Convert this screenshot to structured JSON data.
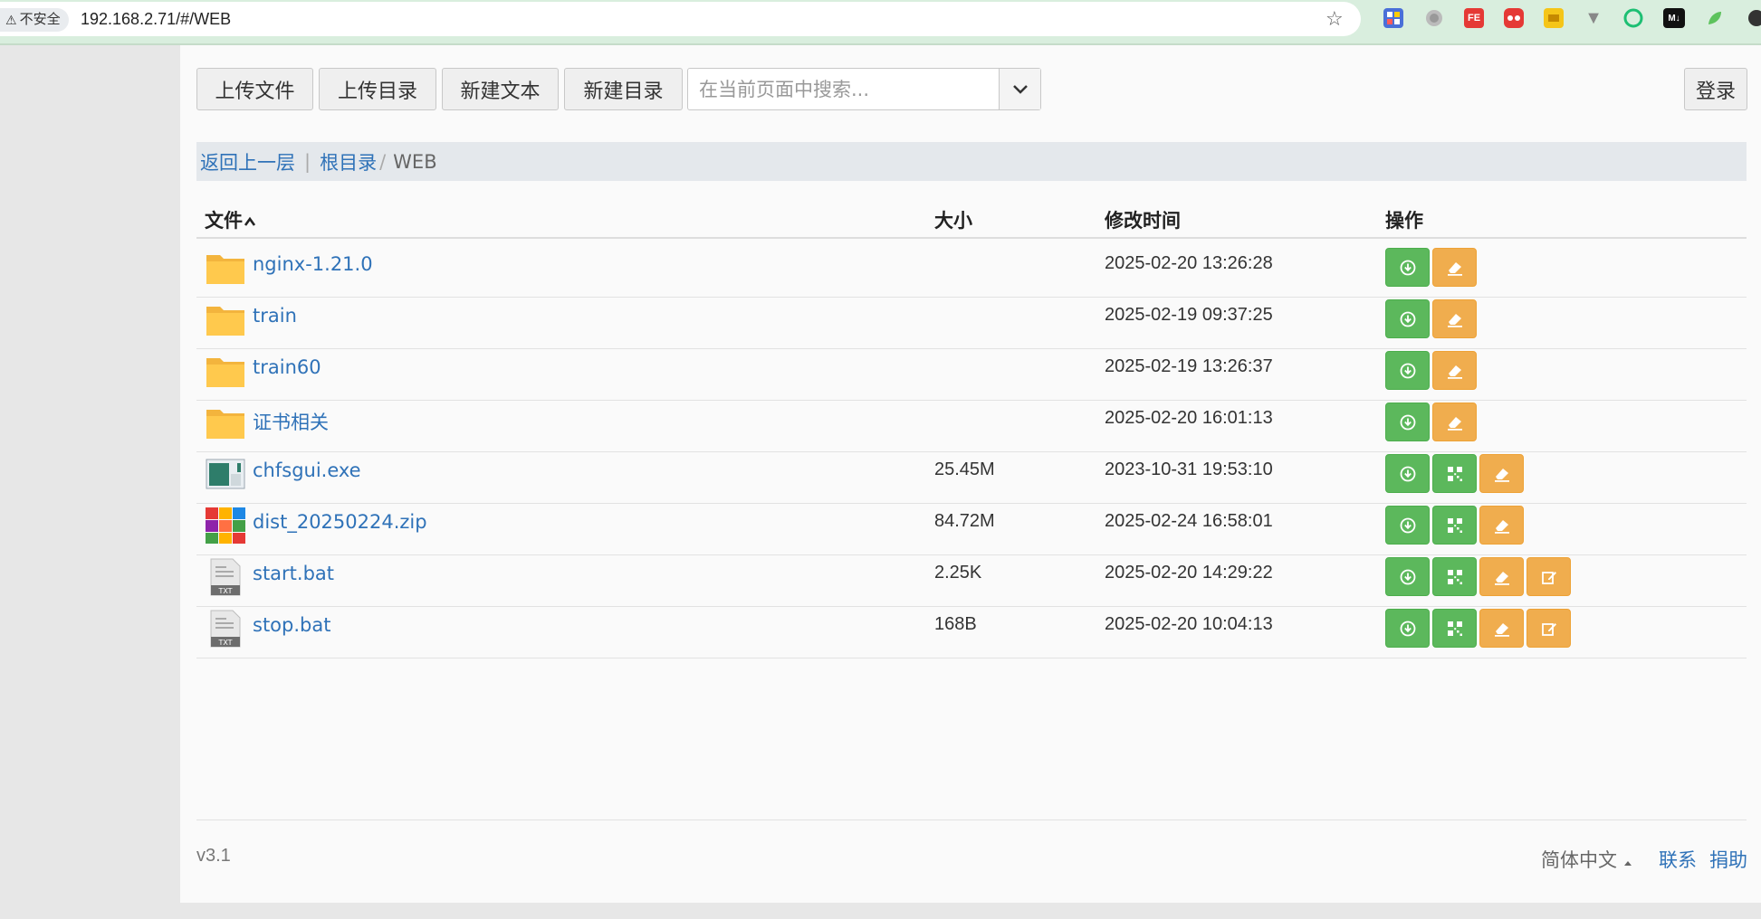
{
  "browser": {
    "security_label": "不安全",
    "url": "192.168.2.71/#/WEB"
  },
  "toolbar": {
    "upload_file": "上传文件",
    "upload_dir": "上传目录",
    "new_text": "新建文本",
    "new_dir": "新建目录",
    "search_placeholder": "在当前页面中搜索...",
    "login": "登录"
  },
  "breadcrumb": {
    "back": "返回上一层",
    "root": "根目录",
    "separator": "/",
    "current": "WEB"
  },
  "table": {
    "headers": {
      "name": "文件",
      "size": "大小",
      "modified": "修改时间",
      "actions": "操作"
    },
    "rows": [
      {
        "name": "nginx-1.21.0",
        "size": "",
        "modified": "2025-02-20 13:26:28",
        "type": "folder",
        "actions": [
          "download",
          "delete"
        ]
      },
      {
        "name": "train",
        "size": "",
        "modified": "2025-02-19 09:37:25",
        "type": "folder",
        "actions": [
          "download",
          "delete"
        ]
      },
      {
        "name": "train60",
        "size": "",
        "modified": "2025-02-19 13:26:37",
        "type": "folder",
        "actions": [
          "download",
          "delete"
        ]
      },
      {
        "name": "证书相关",
        "size": "",
        "modified": "2025-02-20 16:01:13",
        "type": "folder",
        "actions": [
          "download",
          "delete"
        ]
      },
      {
        "name": "chfsgui.exe",
        "size": "25.45M",
        "modified": "2023-10-31 19:53:10",
        "type": "exe",
        "actions": [
          "download",
          "qrcode",
          "delete"
        ]
      },
      {
        "name": "dist_20250224.zip",
        "size": "84.72M",
        "modified": "2025-02-24 16:58:01",
        "type": "zip",
        "actions": [
          "download",
          "qrcode",
          "delete"
        ]
      },
      {
        "name": "start.bat",
        "size": "2.25K",
        "modified": "2025-02-20 14:29:22",
        "type": "txt",
        "actions": [
          "download",
          "qrcode",
          "delete",
          "edit"
        ]
      },
      {
        "name": "stop.bat",
        "size": "168B",
        "modified": "2025-02-20 10:04:13",
        "type": "txt",
        "actions": [
          "download",
          "qrcode",
          "delete",
          "edit"
        ]
      }
    ]
  },
  "footer": {
    "version": "v3.1",
    "language": "简体中文",
    "contact": "联系",
    "donate": "捐助"
  },
  "colors": {
    "link": "#2f72b8",
    "download_green": "#5cb85c",
    "delete_orange": "#f0ad4e",
    "folder_yellow": "#ffc94d"
  }
}
